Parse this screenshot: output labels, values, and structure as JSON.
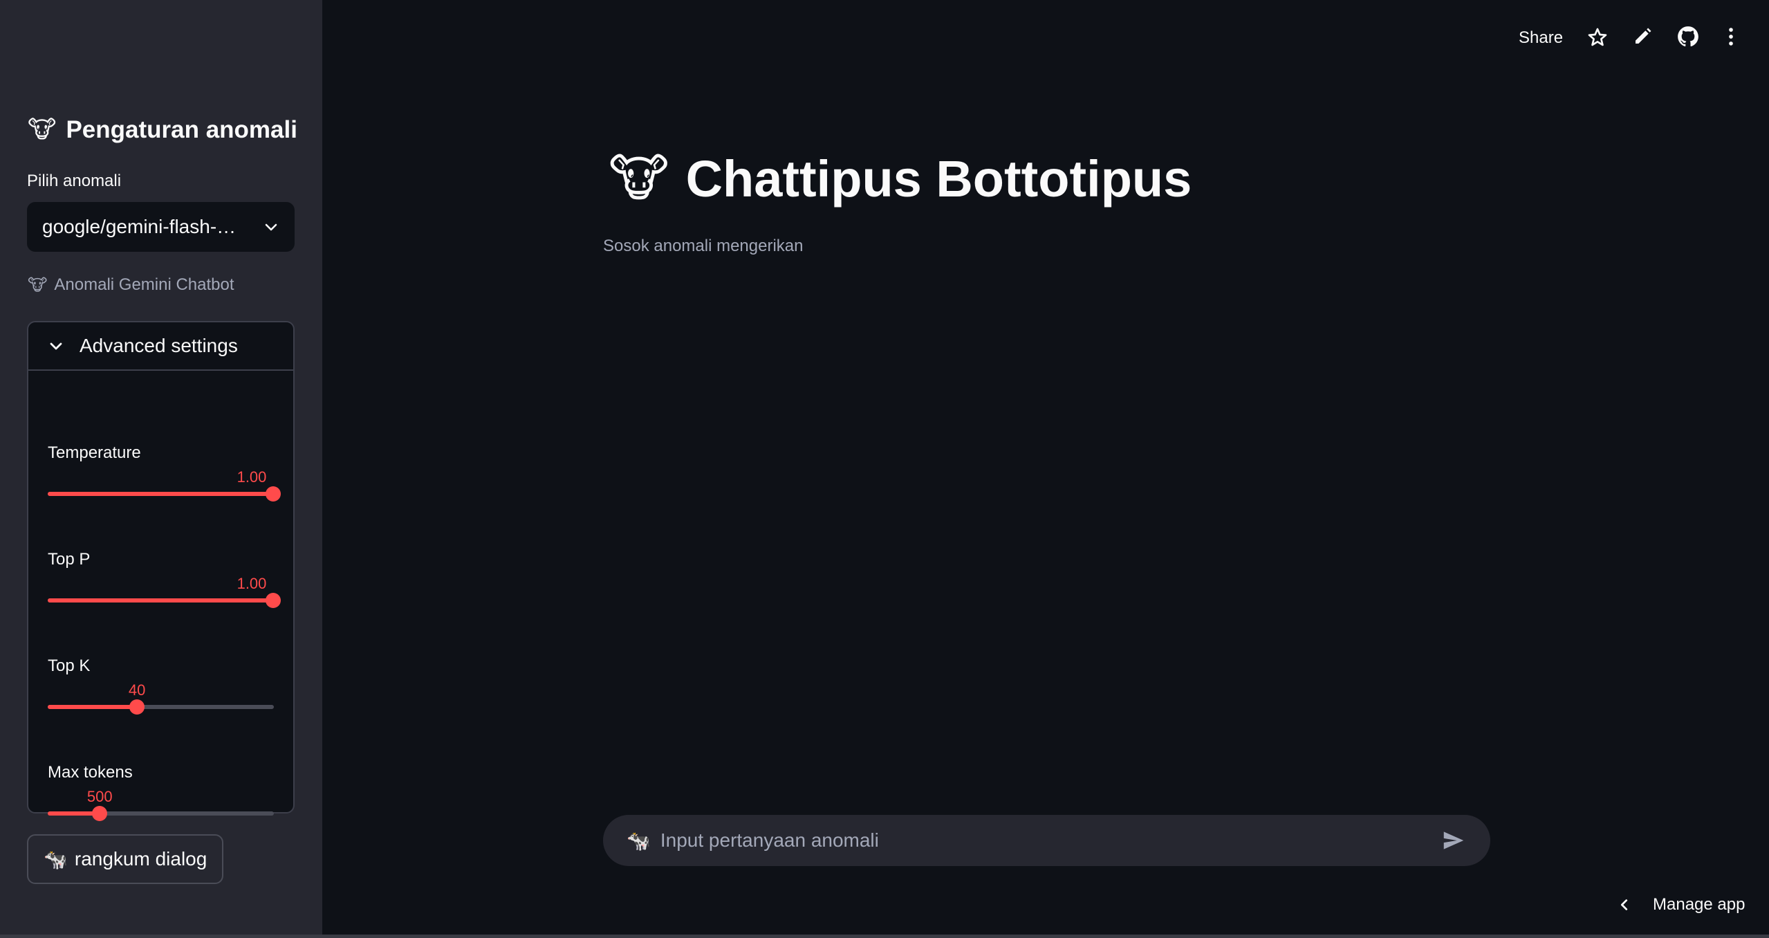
{
  "sidebar": {
    "title": "Pengaturan anomali",
    "title_emoji": "🐮",
    "select_label": "Pilih anomali",
    "select_value": "google/gemini-flash-…",
    "caption_emoji": "🐮",
    "caption": "Anomali Gemini Chatbot",
    "expander_label": "Advanced settings",
    "sliders": [
      {
        "label": "Temperature",
        "value_text": "1.00",
        "fraction": 1.0
      },
      {
        "label": "Top P",
        "value_text": "1.00",
        "fraction": 1.0
      },
      {
        "label": "Top K",
        "value_text": "40",
        "fraction": 0.395
      },
      {
        "label": "Max tokens",
        "value_text": "500",
        "fraction": 0.23
      }
    ],
    "button_emoji": "🐄",
    "button_label": "rangkum dialog"
  },
  "header": {
    "share": "Share",
    "icons": [
      "star-icon",
      "pencil-icon",
      "github-icon",
      "more-icon"
    ]
  },
  "main": {
    "title_emoji": "🐮",
    "title": "Chattipus Bottotipus",
    "subtitle": "Sosok anomali mengerikan"
  },
  "chat": {
    "emoji": "🐄",
    "placeholder": "Input pertanyaan anomali"
  },
  "footer": {
    "manage": "Manage app"
  },
  "colors": {
    "accent": "#ff4b4b",
    "background": "#0e1117",
    "sidebar": "#262730"
  }
}
